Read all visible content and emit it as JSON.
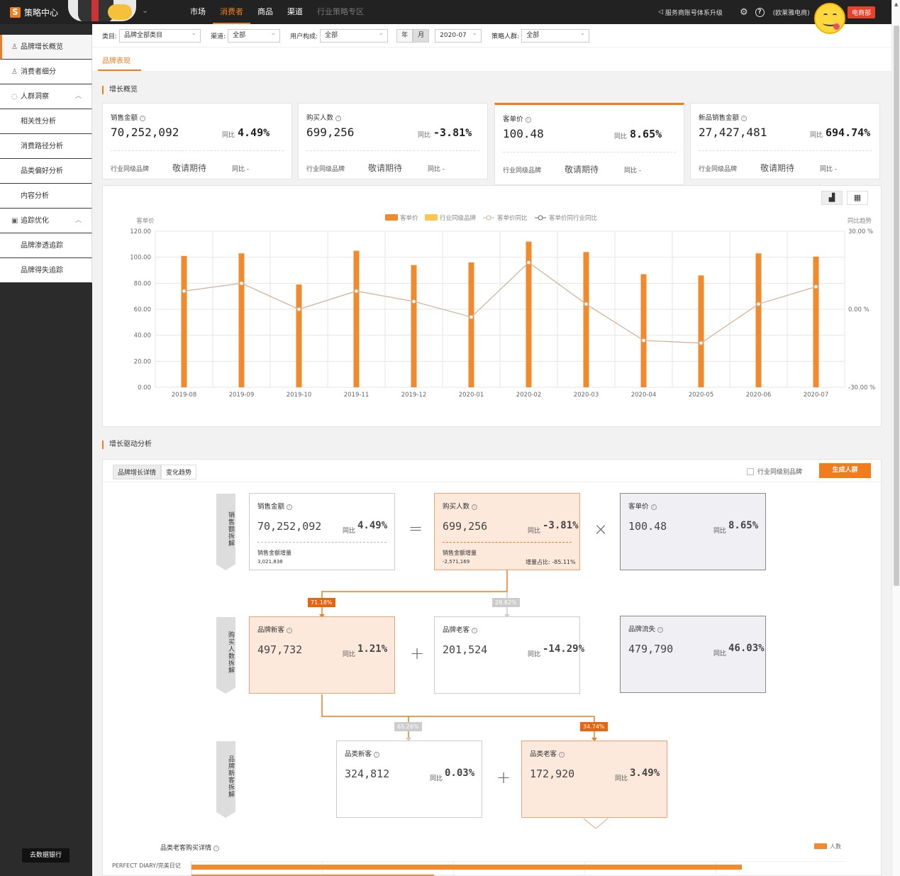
{
  "topbar": {
    "app_name": "策略中心",
    "nav": [
      {
        "label": "市场",
        "state": "normal"
      },
      {
        "label": "消费者",
        "state": "active"
      },
      {
        "label": "商品",
        "state": "normal"
      },
      {
        "label": "渠道",
        "state": "normal"
      },
      {
        "label": "行业策略专区",
        "state": "dim"
      }
    ],
    "notice": "服务商账号体系升级",
    "user": "(欧莱雅电商)",
    "dept_tag": "电商部"
  },
  "sidebar": {
    "items": [
      {
        "label": "品牌增长概览",
        "icon": "user-icon",
        "level": "top",
        "active": true
      },
      {
        "label": "消费者细分",
        "icon": "users-icon",
        "level": "top",
        "active": false
      },
      {
        "label": "人群洞察",
        "icon": "bulb-icon",
        "level": "group",
        "active": false
      },
      {
        "label": "相关性分析",
        "level": "sub",
        "active": false
      },
      {
        "label": "消费路径分析",
        "level": "sub",
        "active": false
      },
      {
        "label": "品类偏好分析",
        "level": "sub",
        "active": false
      },
      {
        "label": "内容分析",
        "level": "sub",
        "active": false
      },
      {
        "label": "追踪优化",
        "icon": "track-icon",
        "level": "group",
        "active": false
      },
      {
        "label": "品牌渗透追踪",
        "level": "sub",
        "active": false
      },
      {
        "label": "品牌得失追踪",
        "level": "sub",
        "active": false
      }
    ],
    "bottom_button": "去数据银行"
  },
  "filters": {
    "category_label": "类目:",
    "category_value": "品牌全部类目",
    "channel_label": "渠道:",
    "channel_value": "全部",
    "user_label": "用户构成:",
    "user_value": "全部",
    "period_year": "年",
    "period_month": "月",
    "date_value": "2020-07",
    "strategy_label": "策略人群:",
    "strategy_value": "全部"
  },
  "tab": {
    "label": "品牌表现"
  },
  "overview": {
    "title": "增长概览",
    "kpis": [
      {
        "title": "销售金额",
        "value": "70,252,092",
        "yoy_label": "同比",
        "yoy": "4.49%",
        "industry_label": "行业同级品牌",
        "industry_value": "敬请期待",
        "industry_yoy": "同比 -"
      },
      {
        "title": "购买人数",
        "value": "699,256",
        "yoy_label": "同比",
        "yoy": "-3.81%",
        "industry_label": "行业同级品牌",
        "industry_value": "敬请期待",
        "industry_yoy": "同比 -"
      },
      {
        "title": "客单价",
        "value": "100.48",
        "yoy_label": "同比",
        "yoy": "8.65%",
        "industry_label": "行业同级品牌",
        "industry_value": "敬请期待",
        "industry_yoy": "同比 -"
      },
      {
        "title": "新品销售金额",
        "value": "27,427,481",
        "yoy_label": "同比",
        "yoy": "694.74%",
        "industry_label": "行业同级品牌",
        "industry_value": "敬请期待",
        "industry_yoy": "同比 -"
      }
    ]
  },
  "chart_data": {
    "type": "bar",
    "ylabel": "客单价",
    "y2label": "同比趋势",
    "categories": [
      "2019-08",
      "2019-09",
      "2019-10",
      "2019-11",
      "2019-12",
      "2020-01",
      "2020-02",
      "2020-03",
      "2020-04",
      "2020-05",
      "2020-06",
      "2020-07"
    ],
    "yticks": [
      "120.00",
      "100.00",
      "80.00",
      "60.00",
      "40.00",
      "20.00",
      "0.00"
    ],
    "y2ticks": [
      "30.00 %",
      "0.00 %",
      "-30.00 %"
    ],
    "ylim": [
      0,
      120
    ],
    "y2lim": [
      -30,
      30
    ],
    "legend": [
      "客单价",
      "行业同级品牌",
      "客单价同比",
      "客单价同行业同比"
    ],
    "series": [
      {
        "name": "客单价",
        "type": "bar",
        "color": "#f08a2c",
        "values": [
          101,
          103,
          79,
          105,
          94,
          96,
          112,
          104,
          87,
          86,
          103,
          100.48
        ]
      },
      {
        "name": "客单价同比",
        "type": "line",
        "color": "#d4b49a",
        "values": [
          7,
          10,
          0,
          7,
          3,
          -3,
          18,
          2,
          -12,
          -13,
          2,
          8.65
        ]
      }
    ],
    "grid": true,
    "legend_position": "top-center"
  },
  "drivers": {
    "title": "增长驱动分析",
    "tabs": [
      "品牌增长详情",
      "变化趋势"
    ],
    "checkbox_label": "行业同级别品牌",
    "generate_button": "生成人群",
    "level_tags": [
      "销售额拆解",
      "购买人数拆解",
      "品牌新客拆解"
    ],
    "boxes": {
      "sales": {
        "title": "销售金额",
        "value": "70,252,092",
        "yoy_label": "同比",
        "yoy": "4.49%",
        "sub_label": "销售金额增量",
        "sub_value": "3,021,838"
      },
      "buyers": {
        "title": "购买人数",
        "value": "699,256",
        "yoy_label": "同比",
        "yoy": "-3.81%",
        "sub_label": "销售金额增量",
        "sub_value": "-2,571,169",
        "share": "增量占比: -85.11%"
      },
      "aov": {
        "title": "客单价",
        "value": "100.48",
        "yoy_label": "同比",
        "yoy": "8.65%"
      },
      "brand_new": {
        "title": "品牌新客",
        "value": "497,732",
        "yoy_label": "同比",
        "yoy": "1.21%"
      },
      "brand_old": {
        "title": "品牌老客",
        "value": "201,524",
        "yoy_label": "同比",
        "yoy": "-14.29%"
      },
      "brand_lost": {
        "title": "品牌流失",
        "value": "479,790",
        "yoy_label": "同比",
        "yoy": "46.03%"
      },
      "cat_new": {
        "title": "品类新客",
        "value": "324,812",
        "yoy_label": "同比",
        "yoy": "0.03%"
      },
      "cat_old": {
        "title": "品类老客",
        "value": "172,920",
        "yoy_label": "同比",
        "yoy": "3.49%"
      }
    },
    "ops": {
      "eq": "=",
      "times": "×",
      "plus": "+"
    },
    "percents": {
      "new_share": "71.18%",
      "old_share": "28.82%",
      "cat_new_share": "65.26%",
      "cat_old_share": "34.74%"
    },
    "bottom_chart": {
      "title": "品类老客购买详情",
      "legend": "人数",
      "rows": [
        {
          "label": "PERFECT DIARY/完美日记",
          "value": 0.84
        },
        {
          "label": "...",
          "value": 0.37
        }
      ]
    }
  }
}
